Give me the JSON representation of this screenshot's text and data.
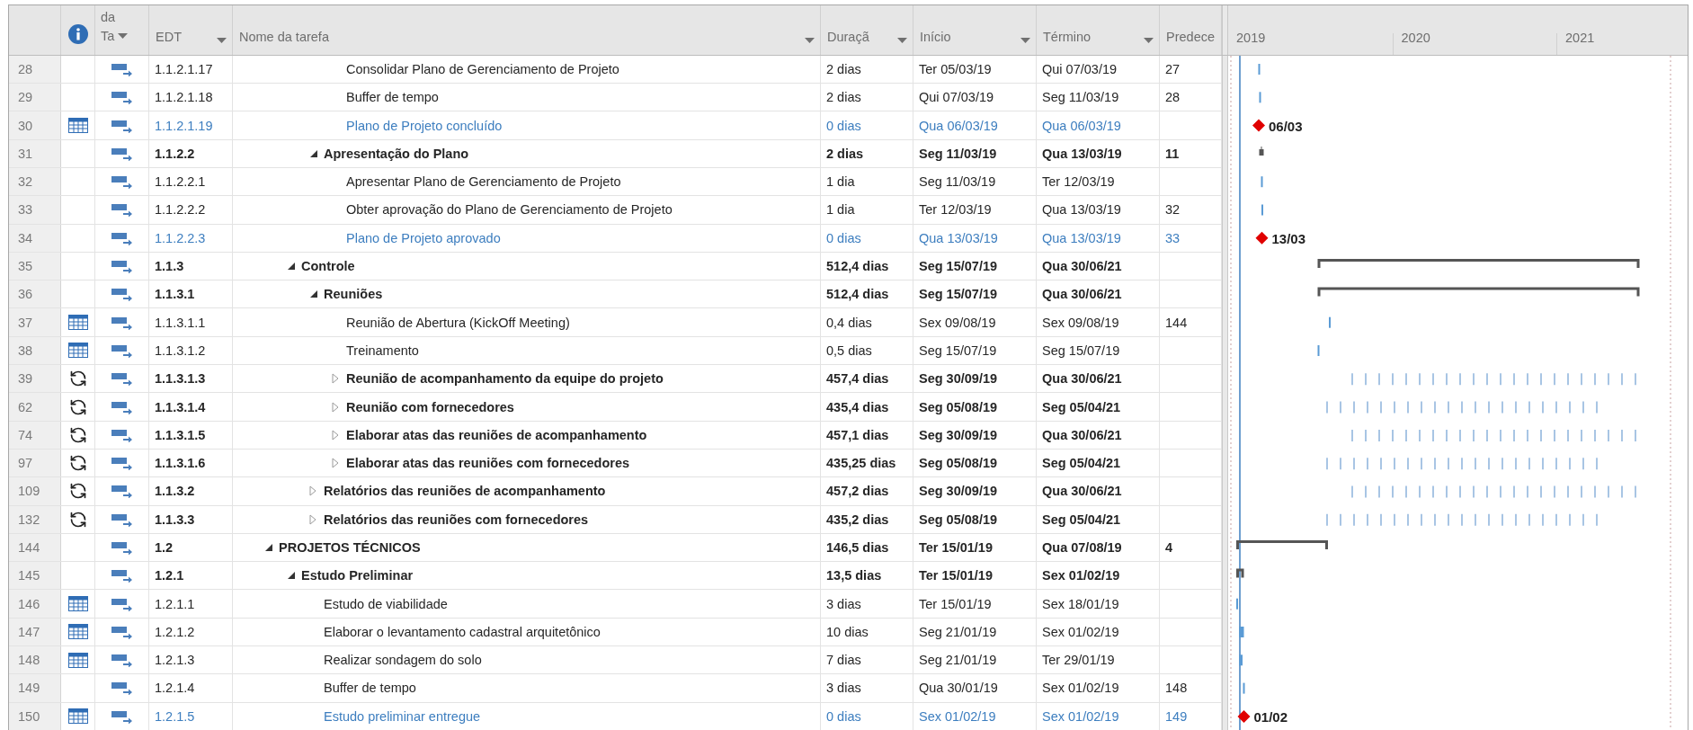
{
  "columns": {
    "mode_top": "da",
    "mode_bottom": "Ta",
    "wbs": "EDT",
    "name": "Nome da tarefa",
    "duration": "Duraçã",
    "start": "Início",
    "finish": "Término",
    "predecessors": "Predece"
  },
  "timescale": [
    "2019",
    "2020",
    "2021"
  ],
  "tasks": [
    {
      "children": [
        {
          "children": [
            {
              "children": [
                {
                  "id": "28",
                  "calendar": false,
                  "wbs": "1.1.2.1.17",
                  "name": "Consolidar Plano de Gerenciamento de Projeto",
                  "duration": "2 dias",
                  "start": "Ter 05/03/19",
                  "finish": "Qui 07/03/19",
                  "predecessors": "27",
                  "kind": "task"
                },
                {
                  "id": "29",
                  "calendar": false,
                  "wbs": "1.1.2.1.18",
                  "name": "Buffer de tempo",
                  "duration": "2 dias",
                  "start": "Qui 07/03/19",
                  "finish": "Seg 11/03/19",
                  "predecessors": "28",
                  "kind": "task"
                },
                {
                  "id": "30",
                  "calendar": true,
                  "wbs": "1.1.2.1.19",
                  "name": "Plano de Projeto concluído",
                  "duration": "0 dias",
                  "start": "Qua 06/03/19",
                  "finish": "Qua 06/03/19",
                  "kind": "milestone",
                  "bar_label": "06/03"
                }
              ]
            },
            {
              "id": "31",
              "calendar": false,
              "wbs": "1.1.2.2",
              "name": "Apresentação do Plano",
              "duration": "2 dias",
              "start": "Seg 11/03/19",
              "finish": "Qua 13/03/19",
              "predecessors": "11",
              "kind": "summary",
              "expanded": true,
              "children": [
                {
                  "id": "32",
                  "calendar": false,
                  "wbs": "1.1.2.2.1",
                  "name": "Apresentar Plano de Gerenciamento de Projeto",
                  "duration": "1 dia",
                  "start": "Seg 11/03/19",
                  "finish": "Ter 12/03/19",
                  "kind": "task"
                },
                {
                  "id": "33",
                  "calendar": false,
                  "wbs": "1.1.2.2.2",
                  "name": "Obter aprovação do Plano de Gerenciamento de Projeto",
                  "duration": "1 dia",
                  "start": "Ter 12/03/19",
                  "finish": "Qua 13/03/19",
                  "predecessors": "32",
                  "kind": "task"
                },
                {
                  "id": "34",
                  "calendar": false,
                  "wbs": "1.1.2.2.3",
                  "name": "Plano de Projeto aprovado",
                  "duration": "0 dias",
                  "start": "Qua 13/03/19",
                  "finish": "Qua 13/03/19",
                  "predecessors": "33",
                  "kind": "milestone",
                  "bar_label": "13/03"
                }
              ]
            }
          ]
        },
        {
          "id": "35",
          "calendar": false,
          "wbs": "1.1.3",
          "name": "Controle",
          "duration": "512,4 dias",
          "start": "Seg 15/07/19",
          "finish": "Qua 30/06/21",
          "kind": "summary",
          "expanded": true,
          "children": [
            {
              "id": "36",
              "calendar": false,
              "wbs": "1.1.3.1",
              "name": "Reuniões",
              "duration": "512,4 dias",
              "start": "Seg 15/07/19",
              "finish": "Qua 30/06/21",
              "kind": "summary",
              "expanded": true,
              "children": [
                {
                  "id": "37",
                  "calendar": true,
                  "wbs": "1.1.3.1.1",
                  "name": "Reunião de Abertura (KickOff Meeting)",
                  "duration": "0,4 dias",
                  "start": "Sex 09/08/19",
                  "finish": "Sex 09/08/19",
                  "predecessors": "144",
                  "kind": "task"
                },
                {
                  "id": "38",
                  "calendar": true,
                  "wbs": "1.1.3.1.2",
                  "name": "Treinamento",
                  "duration": "0,5 dias",
                  "start": "Seg 15/07/19",
                  "finish": "Seg 15/07/19",
                  "kind": "task"
                },
                {
                  "id": "39",
                  "calendar": false,
                  "wbs": "1.1.3.1.3",
                  "name": "Reunião de acompanhamento da equipe do projeto",
                  "duration": "457,4 dias",
                  "start": "Seg 30/09/19",
                  "finish": "Qua 30/06/21",
                  "kind": "recurring",
                  "expanded": false
                },
                {
                  "id": "62",
                  "calendar": false,
                  "wbs": "1.1.3.1.4",
                  "name": "Reunião com fornecedores",
                  "duration": "435,4 dias",
                  "start": "Seg 05/08/19",
                  "finish": "Seg 05/04/21",
                  "kind": "recurring",
                  "expanded": false
                },
                {
                  "id": "74",
                  "calendar": false,
                  "wbs": "1.1.3.1.5",
                  "name": "Elaborar atas das reuniões de acompanhamento",
                  "duration": "457,1 dias",
                  "start": "Seg 30/09/19",
                  "finish": "Qua 30/06/21",
                  "kind": "recurring",
                  "expanded": false
                },
                {
                  "id": "97",
                  "calendar": false,
                  "wbs": "1.1.3.1.6",
                  "name": "Elaborar atas das reuniões com fornecedores",
                  "duration": "435,25 dias",
                  "start": "Seg 05/08/19",
                  "finish": "Seg 05/04/21",
                  "kind": "recurring",
                  "expanded": false
                }
              ]
            },
            {
              "id": "109",
              "calendar": false,
              "wbs": "1.1.3.2",
              "name": "Relatórios das reuniões de acompanhamento",
              "duration": "457,2 dias",
              "start": "Seg 30/09/19",
              "finish": "Qua 30/06/21",
              "kind": "recurring",
              "expanded": false
            },
            {
              "id": "132",
              "calendar": false,
              "wbs": "1.1.3.3",
              "name": "Relatórios das reuniões com fornecedores",
              "duration": "435,2 dias",
              "start": "Seg 05/08/19",
              "finish": "Seg 05/04/21",
              "kind": "recurring",
              "expanded": false
            }
          ]
        }
      ]
    },
    {
      "id": "144",
      "calendar": false,
      "wbs": "1.2",
      "name": "PROJETOS TÉCNICOS",
      "duration": "146,5 dias",
      "start": "Ter 15/01/19",
      "finish": "Qua 07/08/19",
      "predecessors": "4",
      "kind": "summary",
      "expanded": true,
      "children": [
        {
          "id": "145",
          "calendar": false,
          "wbs": "1.2.1",
          "name": "Estudo Preliminar",
          "duration": "13,5 dias",
          "start": "Ter 15/01/19",
          "finish": "Sex 01/02/19",
          "kind": "summary",
          "expanded": true,
          "children": [
            {
              "id": "146",
              "calendar": true,
              "wbs": "1.2.1.1",
              "name": "Estudo de viabilidade",
              "duration": "3 dias",
              "start": "Ter 15/01/19",
              "finish": "Sex 18/01/19",
              "kind": "task"
            },
            {
              "id": "147",
              "calendar": true,
              "wbs": "1.2.1.2",
              "name": "Elaborar o levantamento cadastral arquitetônico",
              "duration": "10 dias",
              "start": "Seg 21/01/19",
              "finish": "Sex 01/02/19",
              "kind": "task"
            },
            {
              "id": "148",
              "calendar": true,
              "wbs": "1.2.1.3",
              "name": "Realizar sondagem do solo",
              "duration": "7 dias",
              "start": "Seg 21/01/19",
              "finish": "Ter 29/01/19",
              "kind": "task"
            },
            {
              "id": "149",
              "calendar": false,
              "wbs": "1.2.1.4",
              "name": "Buffer de tempo",
              "duration": "3 dias",
              "start": "Qua 30/01/19",
              "finish": "Sex 01/02/19",
              "predecessors": "148",
              "kind": "task"
            },
            {
              "id": "150",
              "calendar": true,
              "wbs": "1.2.1.5",
              "name": "Estudo preliminar entregue",
              "duration": "0 dias",
              "start": "Sex 01/02/19",
              "finish": "Sex 01/02/19",
              "predecessors": "149",
              "kind": "milestone",
              "bar_label": "01/02"
            }
          ]
        }
      ]
    }
  ]
}
